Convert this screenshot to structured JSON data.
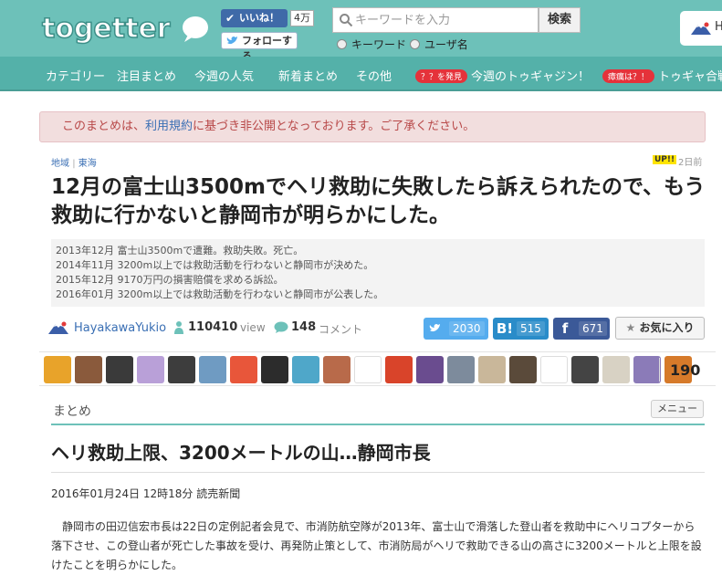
{
  "header": {
    "logo_text": "togetter",
    "like_label": "いいね！",
    "like_count": "4万",
    "follow_label": "フォローする",
    "search_placeholder": "キーワードを入力",
    "search_button": "検索",
    "radio_keyword": "キーワード",
    "radio_user": "ユーザ名",
    "user_initial": "H"
  },
  "nav": {
    "items": [
      "カテゴリー",
      "注目まとめ",
      "今週の人気",
      "新着まとめ",
      "その他"
    ],
    "badge1": "？？を発見",
    "item6": "今週のトゥギャジン！",
    "badge2": "瘴癘は？！",
    "item7": "トゥギャ合戦"
  },
  "notice": {
    "before": "このまとめは、",
    "link": "利用規約",
    "after": "に基づき非公開となっております。ご了承ください。"
  },
  "breadcrumb": {
    "cat1": "地域",
    "sep": "|",
    "cat2": "東海"
  },
  "up_tag": "UP!!",
  "days_ago": "2日前",
  "title": "12月の富士山3500mでヘリ救助に失敗したら訴えられたので、もう救助に行かないと静岡市が明らかにした。",
  "summary_lines": [
    "2013年12月  富士山3500mで遭難。救助失敗。死亡。",
    "2014年11月  3200m以上では救助活動を行わないと静岡市が決めた。",
    "2015年12月  9170万円の損害賠償を求める訴訟。",
    "2016年01月  3200m以上では救助活動を行わないと静岡市が公表した。"
  ],
  "author": {
    "name": "HayakawaYukio",
    "views": "110410",
    "views_label": "view",
    "comments": "148",
    "comments_label": "コメント"
  },
  "share": {
    "twitter": "2030",
    "hatena_icon": "B!",
    "hatena": "515",
    "facebook_icon": "f",
    "facebook": "671",
    "favorite": "お気に入り"
  },
  "avatars": {
    "count": "190",
    "colors": [
      "#e8a32a",
      "#8a5a3c",
      "#3a3a3a",
      "#b9a0d8",
      "#3d3d3d",
      "#6f9bc2",
      "#e8563a",
      "#2c2c2c",
      "#4fa7c9",
      "#b86a4a",
      "#ffffff",
      "#d9442a",
      "#6a4c8f",
      "#7d8b9c",
      "#c9b79a",
      "#5a4a3a",
      "#ffffff",
      "#444444",
      "#d8d2c4",
      "#8b7bb8",
      "#d67a2a"
    ]
  },
  "matome": {
    "label": "まとめ",
    "menu": "メニュー"
  },
  "article": {
    "heading": "ヘリ救助上限、3200メートルの山…静岡市長",
    "date": "2016年01月24日 12時18分  読売新聞",
    "body": "静岡市の田辺信宏市長は22日の定例記者会見で、市消防航空隊が2013年、富士山で滑落した登山者を救助中にヘリコプターから落下させ、この登山者が死亡した事故を受け、再発防止策として、市消防局がヘリで救助できる山の高さに3200メートルと上限を設けたことを明らかにした。"
  }
}
